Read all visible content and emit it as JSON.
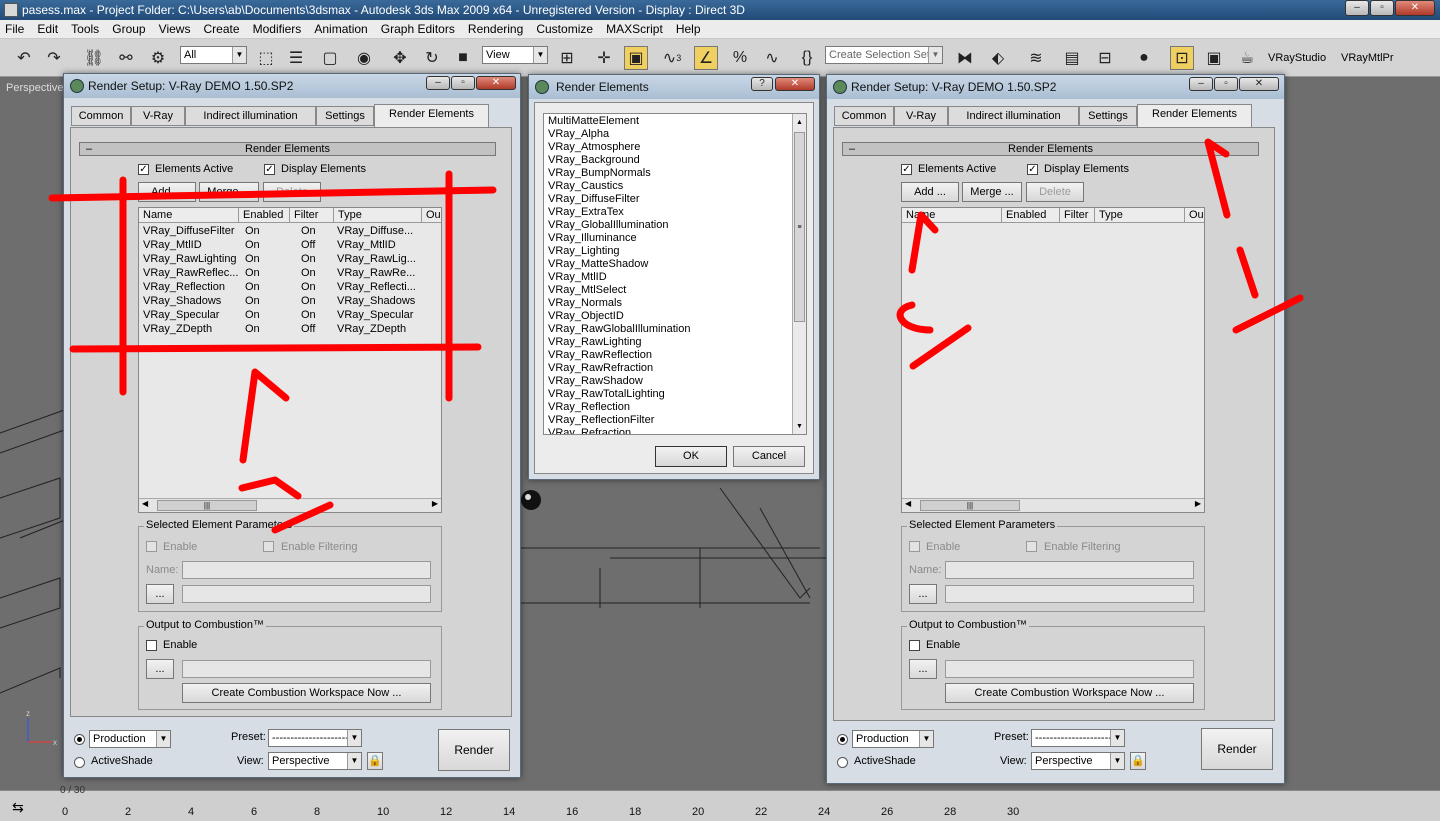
{
  "app": {
    "title": "pasess.max    - Project Folder: C:\\Users\\ab\\Documents\\3dsmax    - Autodesk 3ds Max  2009 x64    - Unregistered Version    - Display : Direct 3D",
    "menu": [
      "File",
      "Edit",
      "Tools",
      "Group",
      "Views",
      "Create",
      "Modifiers",
      "Animation",
      "Graph Editors",
      "Rendering",
      "Customize",
      "MAXScript",
      "Help"
    ]
  },
  "toolbar": {
    "filter_value": "All",
    "refcoord_value": "View",
    "selection_set_placeholder": "Create Selection Set",
    "vray_studio": "VRayStudio",
    "vray_mtl": "VRayMtlPr",
    "snap_number": "3"
  },
  "viewport": {
    "label": "Perspective"
  },
  "render_setup_left": {
    "title": "Render Setup: V-Ray DEMO 1.50.SP2",
    "tabs": [
      "Common",
      "V-Ray",
      "Indirect illumination",
      "Settings",
      "Render Elements"
    ],
    "rollout_title": "Render Elements",
    "rollout_sign": "–",
    "elements_active": "Elements Active",
    "display_elements": "Display Elements",
    "add": "Add ...",
    "merge": "Merge ...",
    "delete": "Delete",
    "columns": [
      "Name",
      "Enabled",
      "Filter",
      "Type",
      "Ou"
    ],
    "rows": [
      [
        "VRay_DiffuseFilter",
        "On",
        "On",
        "VRay_Diffuse..."
      ],
      [
        "VRay_MtlID",
        "On",
        "Off",
        "VRay_MtlID"
      ],
      [
        "VRay_RawLighting",
        "On",
        "On",
        "VRay_RawLig..."
      ],
      [
        "VRay_RawReflec...",
        "On",
        "On",
        "VRay_RawRe..."
      ],
      [
        "VRay_Reflection",
        "On",
        "On",
        "VRay_Reflecti..."
      ],
      [
        "VRay_Shadows",
        "On",
        "On",
        "VRay_Shadows"
      ],
      [
        "VRay_Specular",
        "On",
        "On",
        "VRay_Specular"
      ],
      [
        "VRay_ZDepth",
        "On",
        "Off",
        "VRay_ZDepth"
      ]
    ],
    "selected_params": "Selected Element Parameters",
    "enable": "Enable",
    "enable_filtering": "Enable Filtering",
    "name_label": "Name:",
    "browse": "...",
    "combustion_group": "Output to Combustion™",
    "combustion_enable": "Enable",
    "combustion_btn": "Create Combustion Workspace Now ...",
    "production": "Production",
    "activeshade": "ActiveShade",
    "preset_label": "Preset:",
    "preset_value": "----------------------",
    "view_label": "View:",
    "view_value": "Perspective",
    "render": "Render"
  },
  "render_elements_dialog": {
    "title": "Render Elements",
    "help": "?",
    "close": "✕",
    "items": [
      "MultiMatteElement",
      "VRay_Alpha",
      "VRay_Atmosphere",
      "VRay_Background",
      "VRay_BumpNormals",
      "VRay_Caustics",
      "VRay_DiffuseFilter",
      "VRay_ExtraTex",
      "VRay_GlobalIllumination",
      "VRay_Illuminance",
      "VRay_Lighting",
      "VRay_MatteShadow",
      "VRay_MtlID",
      "VRay_MtlSelect",
      "VRay_Normals",
      "VRay_ObjectID",
      "VRay_RawGlobalIllumination",
      "VRay_RawLighting",
      "VRay_RawReflection",
      "VRay_RawRefraction",
      "VRay_RawShadow",
      "VRay_RawTotalLighting",
      "VRay_Reflection",
      "VRay_ReflectionFilter",
      "VRay_Refraction"
    ],
    "ok": "OK",
    "cancel": "Cancel"
  },
  "render_setup_right": {
    "title": "Render Setup: V-Ray DEMO 1.50.SP2",
    "tabs": [
      "Common",
      "V-Ray",
      "Indirect illumination",
      "Settings",
      "Render Elements"
    ],
    "rollout_title": "Render Elements",
    "rollout_sign": "–",
    "elements_active": "Elements Active",
    "display_elements": "Display Elements",
    "add": "Add ...",
    "merge": "Merge ...",
    "delete": "Delete",
    "columns": [
      "Name",
      "Enabled",
      "Filter",
      "Type",
      "Ou"
    ],
    "selected_params": "Selected Element Parameters",
    "enable": "Enable",
    "enable_filtering": "Enable Filtering",
    "name_label": "Name:",
    "browse": "...",
    "combustion_group": "Output to Combustion™",
    "combustion_enable": "Enable",
    "combustion_btn": "Create Combustion Workspace Now ...",
    "production": "Production",
    "activeshade": "ActiveShade",
    "preset_label": "Preset:",
    "preset_value": "----------------------",
    "view_label": "View:",
    "view_value": "Perspective",
    "render": "Render"
  },
  "timeline": {
    "frame": "0 / 30",
    "ticks": [
      "0",
      "2",
      "4",
      "6",
      "8",
      "10",
      "12",
      "14",
      "16",
      "18",
      "20",
      "22",
      "24",
      "26",
      "28",
      "30"
    ]
  },
  "colors": {
    "annotation": "#ff0000",
    "titlebar": "#2c5a8a",
    "panel": "#d4d4d4"
  }
}
